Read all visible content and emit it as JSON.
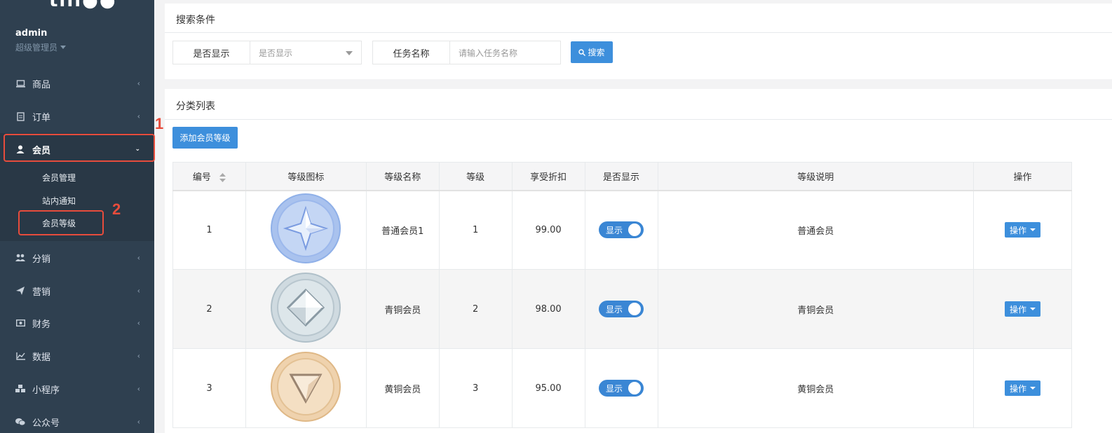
{
  "sidebar": {
    "logo_fragment": "tlll●●",
    "username": "admin",
    "role": "超级管理员",
    "menu": [
      {
        "label": "商品",
        "icon": "laptop-icon"
      },
      {
        "label": "订单",
        "icon": "clipboard-icon"
      },
      {
        "label": "会员",
        "icon": "user-icon"
      },
      {
        "label": "分销",
        "icon": "users-icon"
      },
      {
        "label": "营销",
        "icon": "paper-plane-icon"
      },
      {
        "label": "财务",
        "icon": "money-icon"
      },
      {
        "label": "数据",
        "icon": "line-chart-icon"
      },
      {
        "label": "小程序",
        "icon": "cubes-icon"
      },
      {
        "label": "公众号",
        "icon": "wechat-icon"
      }
    ],
    "submenu": [
      "会员管理",
      "站内通知",
      "会员等级"
    ]
  },
  "annotations": {
    "one": "1",
    "two": "2",
    "color": "#e74c3c"
  },
  "search": {
    "title": "搜索条件",
    "show_label": "是否显示",
    "show_placeholder": "是否显示",
    "task_label": "任务名称",
    "task_placeholder": "请输入任务名称",
    "search_button": "搜索"
  },
  "list": {
    "title": "分类列表",
    "add_button": "添加会员等级",
    "columns": [
      "编号",
      "等级图标",
      "等级名称",
      "等级",
      "享受折扣",
      "是否显示",
      "等级说明",
      "操作"
    ],
    "rows": [
      {
        "id": "1",
        "name": "普通会员1",
        "level": "1",
        "discount": "99.00",
        "show": "显示",
        "desc": "普通会员",
        "action": "操作",
        "badge": "diamond-star"
      },
      {
        "id": "2",
        "name": "青铜会员",
        "level": "2",
        "discount": "98.00",
        "show": "显示",
        "desc": "青铜会员",
        "action": "操作",
        "badge": "diamond"
      },
      {
        "id": "3",
        "name": "黄铜会员",
        "level": "3",
        "discount": "95.00",
        "show": "显示",
        "desc": "黄铜会员",
        "action": "操作",
        "badge": "triangle"
      }
    ]
  },
  "colors": {
    "sidebar": "#2f4050",
    "primary": "#3d8fdc",
    "badge_blue": "#a9c2ee",
    "badge_silver": "#cfdae0",
    "badge_bronze": "#efd2ad"
  }
}
